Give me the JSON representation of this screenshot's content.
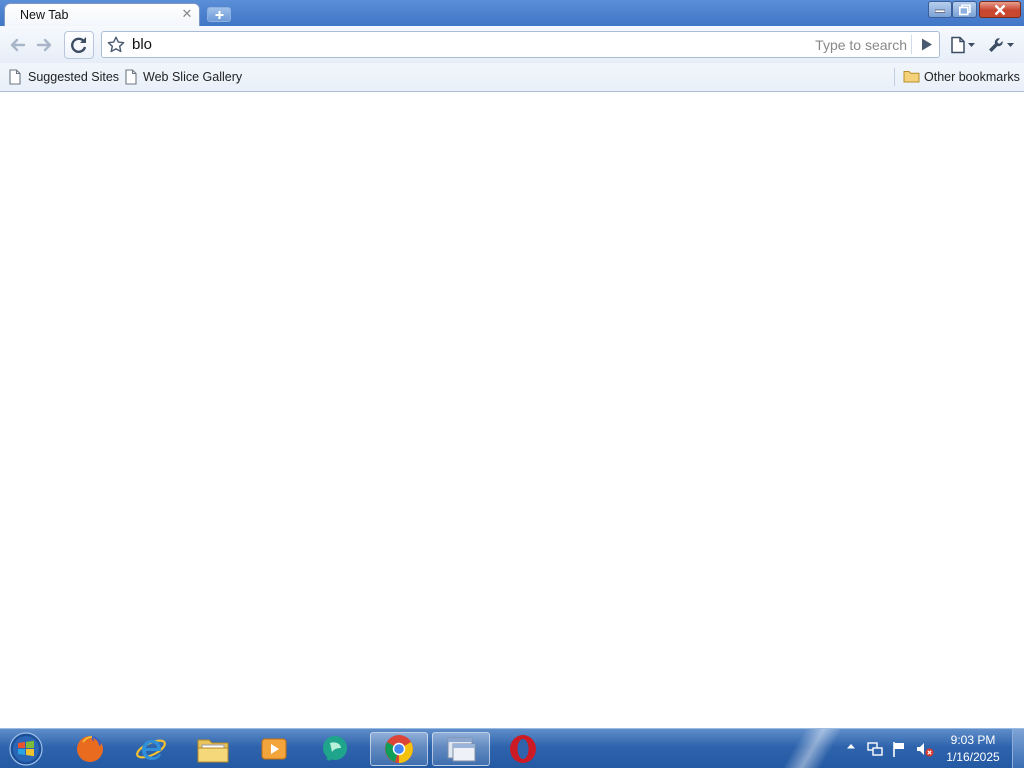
{
  "browser": {
    "tab": {
      "title": "New Tab",
      "close_icon": "close-icon"
    },
    "new_tab_icon": "plus-icon",
    "window_controls": [
      "minimize-icon",
      "restore-icon",
      "close-icon"
    ]
  },
  "toolbar": {
    "back_icon": "arrow-left-icon",
    "forward_icon": "arrow-right-icon",
    "reload_icon": "reload-icon",
    "bookmark_star_icon": "star-icon",
    "address_value": "blo",
    "search_placeholder": "Type to search",
    "go_icon": "play-icon",
    "page_menu_icon": "page-icon",
    "wrench_menu_icon": "wrench-icon"
  },
  "bookmarks": {
    "items": [
      {
        "label": "Suggested Sites",
        "icon": "page-icon"
      },
      {
        "label": "Web Slice Gallery",
        "icon": "page-icon"
      }
    ],
    "other": {
      "label": "Other bookmarks",
      "icon": "folder-icon"
    }
  },
  "taskbar": {
    "apps": [
      "windows-start-icon",
      "firefox-icon",
      "internet-explorer-icon",
      "file-explorer-icon",
      "media-player-icon",
      "messenger-icon",
      "chrome-icon",
      "window-app-icon",
      "opera-icon"
    ],
    "tray": [
      "show-hidden-icons-icon",
      "network-icon",
      "action-center-flag-icon",
      "volume-muted-icon"
    ],
    "clock": {
      "time": "9:03 PM",
      "date": "1/16/2025"
    }
  },
  "colors": {
    "titlebar": "#4a7fce",
    "taskbar": "#2f64ad",
    "close_button": "#c8452f",
    "content": "#ffffff"
  }
}
